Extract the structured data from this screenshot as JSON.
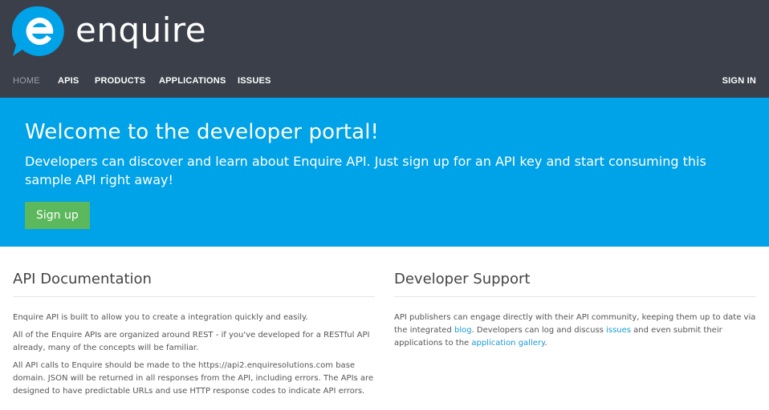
{
  "brand": {
    "name": "enquire"
  },
  "nav": {
    "items": [
      "HOME",
      "APIS",
      "PRODUCTS",
      "APPLICATIONS",
      "ISSUES"
    ],
    "signin": "SIGN IN"
  },
  "hero": {
    "title": "Welcome to the developer portal!",
    "subtitle": "Developers can discover and learn about Enquire API. Just sign up for an API key and start consuming this sample API right away!",
    "button": "Sign up"
  },
  "docs": {
    "title": "API Documentation",
    "p1": "Enquire API is built to allow you to create a integration quickly and easily.",
    "p2": "All of the Enquire APIs are organized around REST - if you've developed for a RESTful API already, many of the concepts will be familiar.",
    "p3": "All API calls to Enquire should be made to the https://api2.enquiresolutions.com base domain. JSON will be returned in all responses from the API, including errors. The APIs are designed to have predictable URLs and use HTTP response codes to indicate API errors."
  },
  "support": {
    "title": "Developer Support",
    "text1": "API publishers can engage directly with their API community, keeping them up to date via the integrated ",
    "link_blog": "blog",
    "text2": ". Developers can log and discuss ",
    "link_issues": "issues",
    "text3": " and even submit their applications to the ",
    "link_gallery": "application gallery",
    "text4": "."
  },
  "colors": {
    "header_bg": "#3b3f4a",
    "hero_bg": "#00a2e8",
    "button_bg": "#5cb85c",
    "link": "#1a9ad6"
  },
  "icons": {
    "logo": "enquire-logo-icon"
  }
}
